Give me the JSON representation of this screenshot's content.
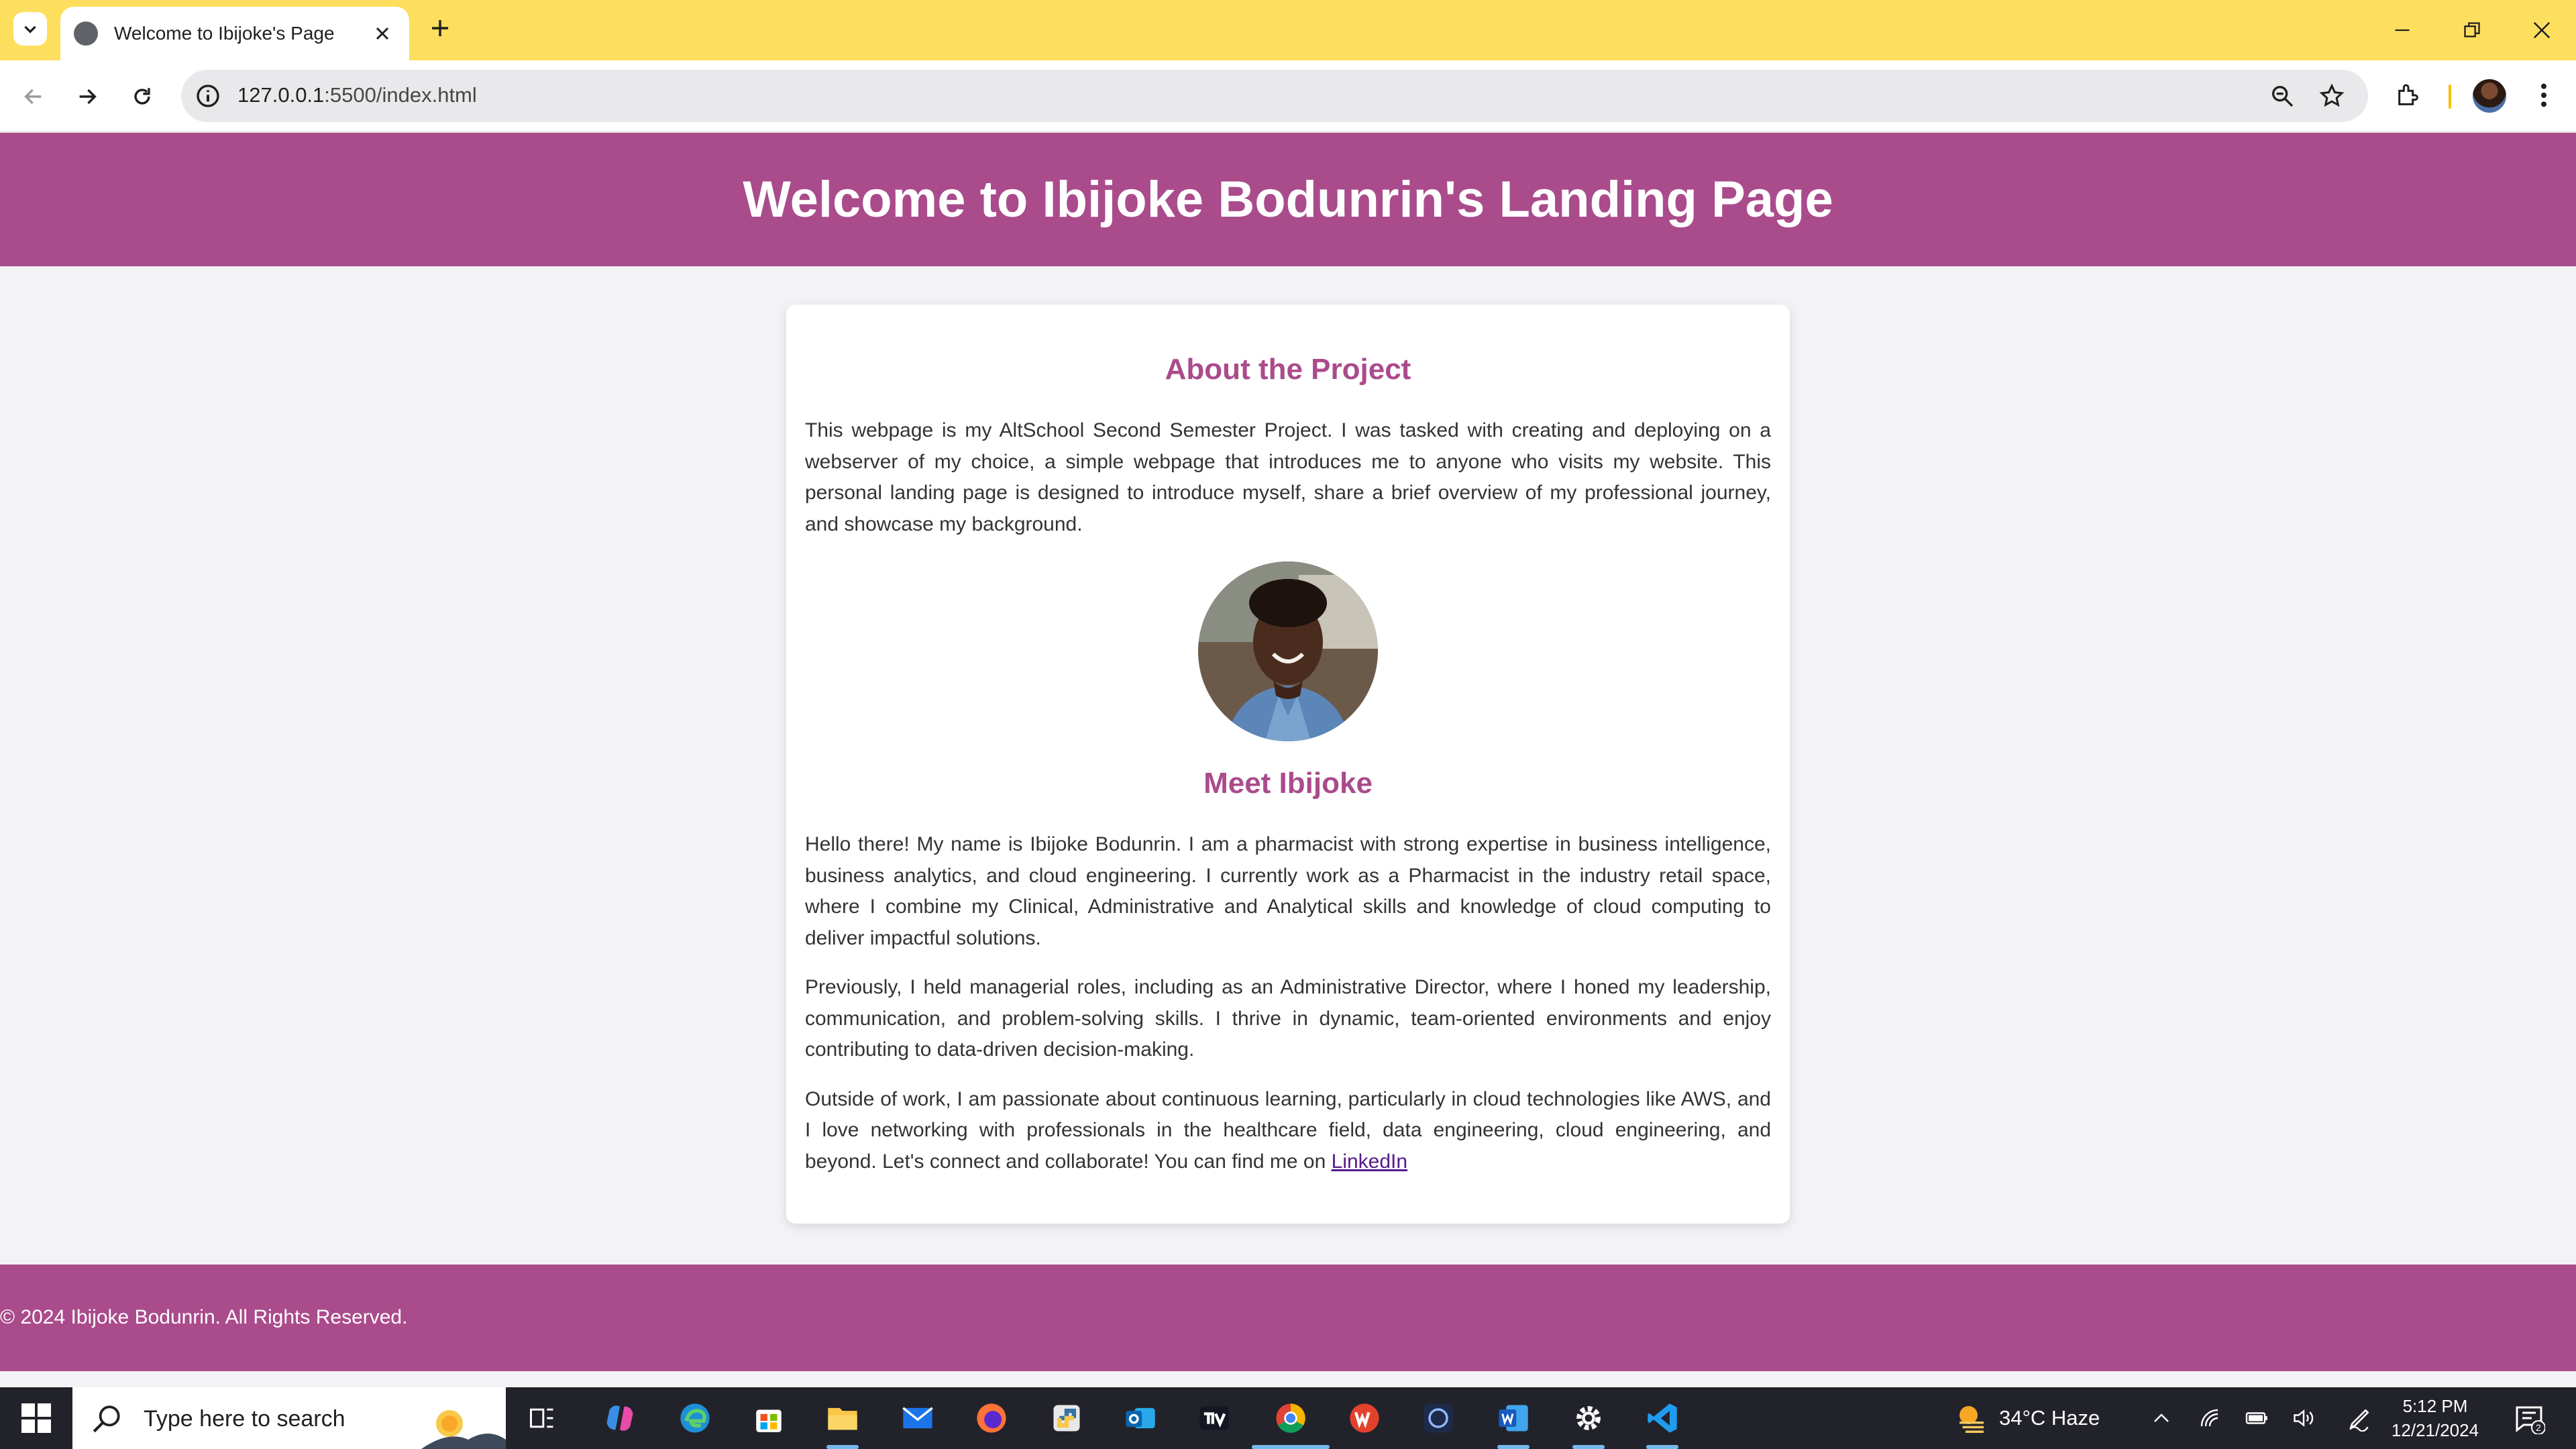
{
  "browser": {
    "tab_title": "Welcome to Ibijoke's Page",
    "url_host": "127.0.0.1",
    "url_path": ":5500/index.html"
  },
  "header": {
    "title": "Welcome to Ibijoke Bodunrin's Landing Page"
  },
  "about": {
    "heading": "About the Project",
    "text": "This webpage is my AltSchool Second Semester Project. I was tasked with creating and deploying on a webserver of my choice, a simple webpage that introduces me to anyone who visits my website. This personal landing page is designed to introduce myself, share a brief overview of my professional journey, and showcase my background."
  },
  "meet": {
    "heading": "Meet Ibijoke",
    "p1": "Hello there! My name is Ibijoke Bodunrin. I am a pharmacist with strong expertise in business intelligence, business analytics, and cloud engineering. I currently work as a Pharmacist in the industry retail space, where I combine my Clinical, Administrative and Analytical skills and knowledge of cloud computing to deliver impactful solutions.",
    "p2": "Previously, I held managerial roles, including as an Administrative Director, where I honed my leadership, communication, and problem-solving skills. I thrive in dynamic, team-oriented environments and enjoy contributing to data-driven decision-making.",
    "p3": "Outside of work, I am passionate about continuous learning, particularly in cloud technologies like AWS, and I love networking with professionals in the healthcare field, data engineering, cloud engineering, and beyond. Let's connect and collaborate! You can find me on",
    "link_label": "LinkedIn"
  },
  "footer": {
    "copyright": "© 2024 Ibijoke Bodunrin. All Rights Reserved."
  },
  "taskbar": {
    "search_placeholder": "Type here to search",
    "weather": "34°C  Haze",
    "time": "5:12 PM",
    "date": "12/21/2024",
    "notification_count": "2"
  },
  "colors": {
    "brand": "#aa4b8c",
    "chrome": "#fede5d",
    "taskbar": "#22232a"
  }
}
